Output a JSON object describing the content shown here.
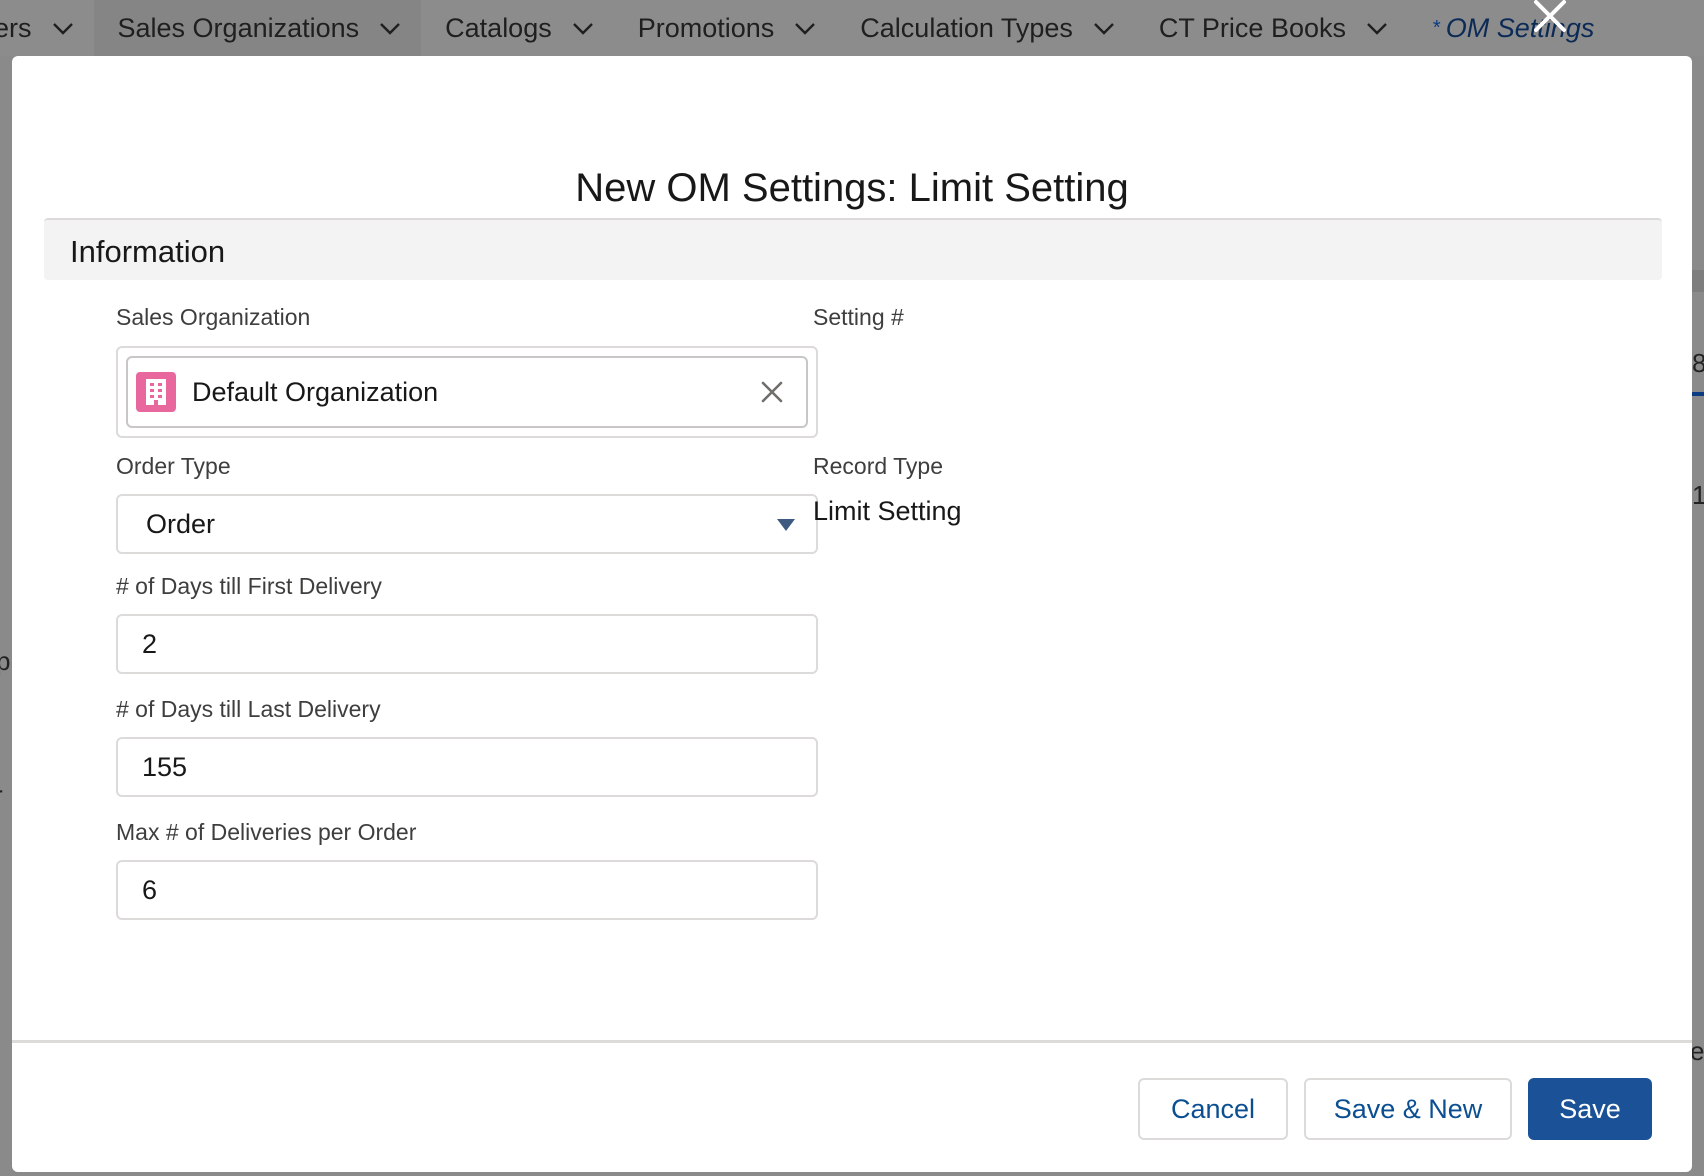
{
  "nav": {
    "tabs": [
      {
        "label": "ers"
      },
      {
        "label": "Sales Organizations"
      },
      {
        "label": "Catalogs"
      },
      {
        "label": "Promotions"
      },
      {
        "label": "Calculation Types"
      },
      {
        "label": "CT Price Books"
      }
    ],
    "current_tab": {
      "marker": "*",
      "label": "OM Settings"
    }
  },
  "background": {
    "edge_texts": [
      "8",
      "1",
      "p",
      "r",
      "er"
    ]
  },
  "modal": {
    "title": "New OM Settings: Limit Setting",
    "section_title": "Information",
    "sales_org": {
      "label": "Sales Organization",
      "value": "Default Organization"
    },
    "setting_no": {
      "label": "Setting #",
      "value": ""
    },
    "order_type": {
      "label": "Order Type",
      "value": "Order"
    },
    "record_type": {
      "label": "Record Type",
      "value": "Limit Setting"
    },
    "days_first": {
      "label": "# of Days till First Delivery",
      "value": "2"
    },
    "days_last": {
      "label": "# of Days till Last Delivery",
      "value": "155"
    },
    "max_deliveries": {
      "label": "Max # of Deliveries per Order",
      "value": "6"
    },
    "buttons": {
      "cancel": "Cancel",
      "save_new": "Save & New",
      "save": "Save"
    }
  },
  "colors": {
    "brand": "#1b5297",
    "link": "#0b4f91",
    "org_icon": "#e8679d"
  }
}
